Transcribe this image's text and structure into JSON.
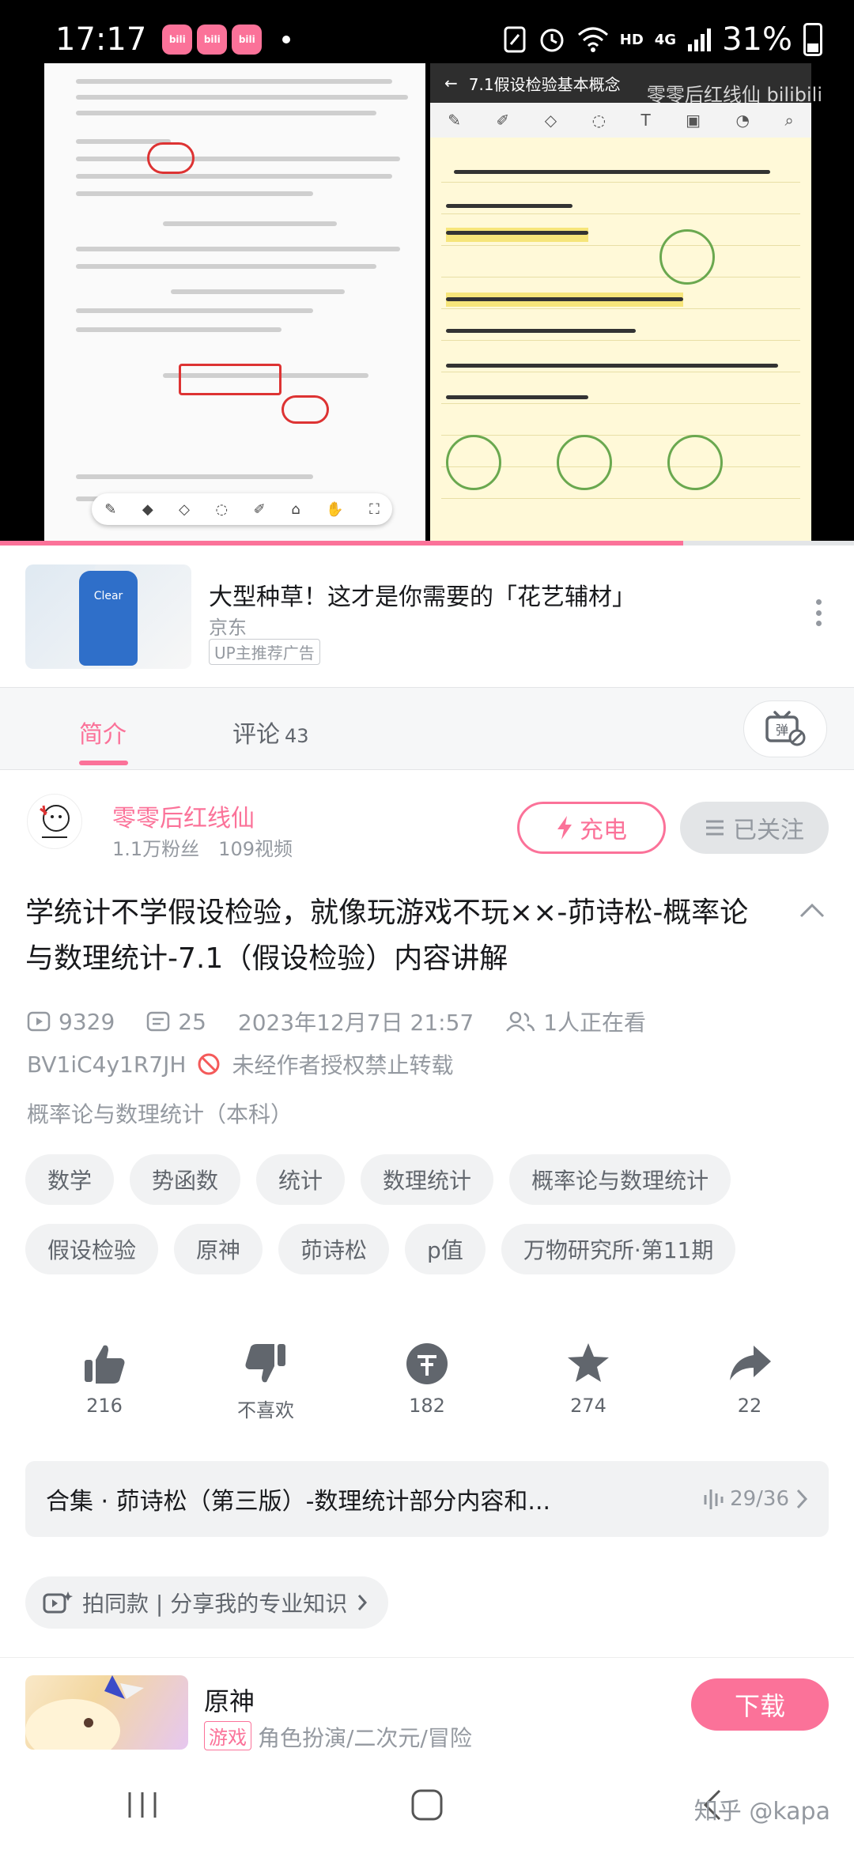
{
  "status_bar": {
    "time": "17:17",
    "net_label": "HD",
    "signal_label": "4G",
    "battery": "31%"
  },
  "video": {
    "note_title": "7.1假设检验基本概念",
    "watermark": "零零后红线仙 bilibili",
    "progress": 0.8
  },
  "ad": {
    "title": "大型种草！这才是你需要的「花艺辅材」",
    "source": "京东",
    "tag": "UP主推荐广告",
    "product_label": "Clear"
  },
  "tabs": {
    "intro": "简介",
    "comments": "评论",
    "comment_count": "43"
  },
  "uploader": {
    "name": "零零后红线仙",
    "fans": "1.1万粉丝",
    "videos": "109视频",
    "charge_label": "充电",
    "follow_label": "已关注"
  },
  "video_info": {
    "title": "学统计不学假设检验，就像玩游戏不玩××-茆诗松-概率论与数理统计-7.1（假设检验）内容讲解",
    "plays": "9329",
    "danmaku": "25",
    "date": "2023年12月7日 21:57",
    "watching": "1人正在看",
    "bvid": "BV1iC4y1R7JH",
    "copyright": "未经作者授权禁止转载",
    "category": "概率论与数理统计（本科）"
  },
  "tags": [
    "数学",
    "势函数",
    "统计",
    "数理统计",
    "概率论与数理统计",
    "假设检验",
    "原神",
    "茆诗松",
    "p值",
    "万物研究所·第11期"
  ],
  "actions": [
    {
      "icon": "like-icon",
      "label": "216"
    },
    {
      "icon": "dislike-icon",
      "label": "不喜欢"
    },
    {
      "icon": "coin-icon",
      "label": "182"
    },
    {
      "icon": "star-icon",
      "label": "274"
    },
    {
      "icon": "share-icon",
      "label": "22"
    }
  ],
  "collection": {
    "title": "合集 · 茆诗松（第三版）-数理统计部分内容和...",
    "count": "29/36"
  },
  "pai": {
    "label": "拍同款 | 分享我的专业知识"
  },
  "game": {
    "name": "原神",
    "tag": "游戏",
    "genre": "角色扮演/二次元/冒险",
    "download": "下载"
  },
  "watermark": "知乎 @kapa",
  "colors": {
    "accent": "#fb7299",
    "text": "#18191c",
    "muted": "#9499a0"
  }
}
